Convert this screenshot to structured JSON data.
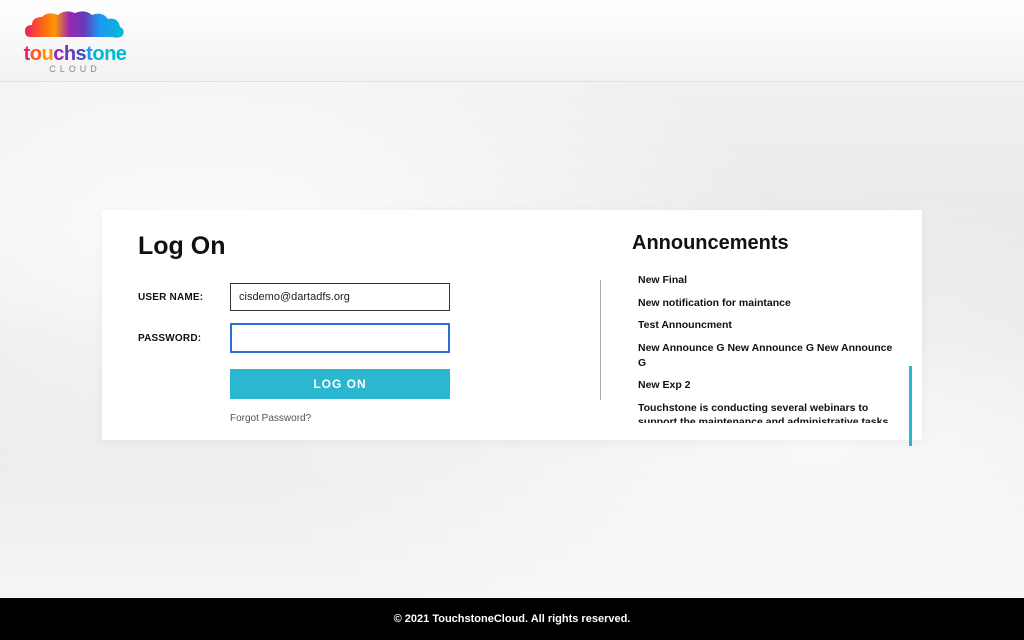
{
  "brand": {
    "name": "touchstone",
    "subtitle": "CLOUD"
  },
  "login": {
    "heading": "Log On",
    "username_label": "USER NAME:",
    "username_value": "cisdemo@dartadfs.org",
    "password_label": "PASSWORD:",
    "password_value": "",
    "button_label": "LOG ON",
    "forgot_label": "Forgot Password?"
  },
  "announcements": {
    "heading": "Announcements",
    "items": [
      "New Final",
      "New notification for maintance",
      "Test Announcment",
      "New Announce G New Announce G New Announce G",
      "New Exp 2"
    ],
    "description": "Touchstone is conducting several webinars to support the maintenance and administrative tasks within our product suite.   Contact your account manager for more details & do."
  },
  "footer": {
    "text": "© 2021 TouchstoneCloud. All rights reserved."
  }
}
